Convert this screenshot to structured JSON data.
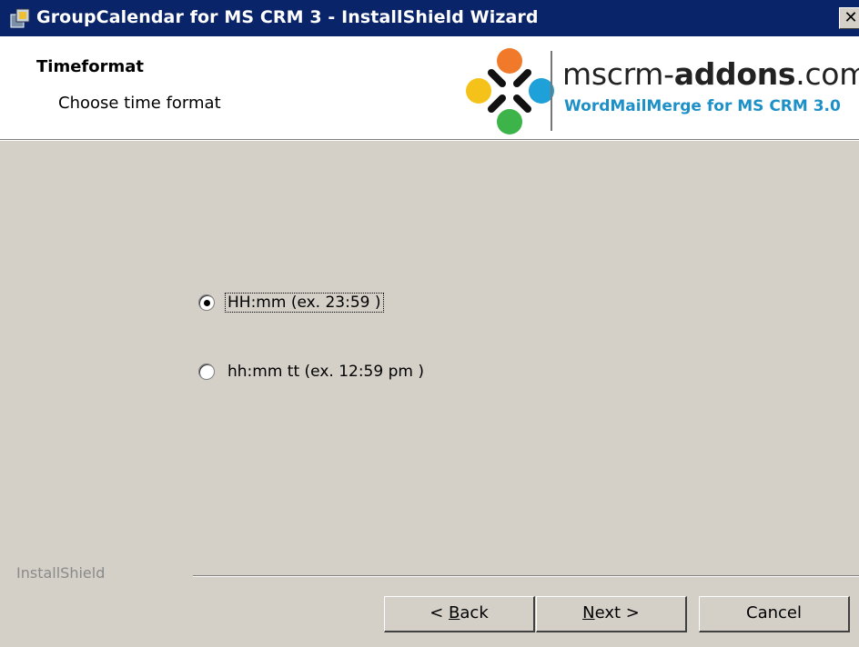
{
  "window": {
    "title": "GroupCalendar for MS CRM 3 - InstallShield Wizard",
    "close_label": "✕"
  },
  "header": {
    "title": "Timeformat",
    "subtitle": "Choose time format",
    "brand_prefix": "mscrm-",
    "brand_bold": "addons",
    "brand_suffix": ".com",
    "tagline": "WordMailMerge for MS CRM 3.0"
  },
  "options": [
    {
      "label": "HH:mm (ex. 23:59 )",
      "selected": true
    },
    {
      "label": "hh:mm tt (ex. 12:59 pm )",
      "selected": false
    }
  ],
  "footer": {
    "installshield": "InstallShield",
    "back_pre": "< ",
    "back_ul": "B",
    "back_post": "ack",
    "next_ul": "N",
    "next_post": "ext >",
    "cancel": "Cancel"
  },
  "colors": {
    "titlebar": "#0a246a",
    "dialog": "#d4d0c8",
    "tagline": "#1e90c8"
  }
}
